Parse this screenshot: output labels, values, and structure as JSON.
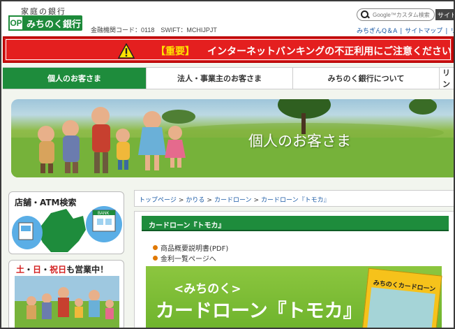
{
  "header": {
    "tagline": "家庭の銀行",
    "logo_mark": "OP",
    "logo_text": "みちのく銀行",
    "bank_code": "金融機関コード：0118　SWIFT：MCHIJPJT",
    "search_placeholder": "Google™カスタム検索",
    "search_button": "サイト",
    "util_links": [
      "みちぎんQ＆A",
      "サイトマップ",
      "リン"
    ]
  },
  "alert": {
    "badge": "【重要】",
    "message": "インターネットバンキングの不正利用にご注意ください"
  },
  "nav": {
    "items": [
      "個人のお客さま",
      "法人・事業主のお客さま",
      "みちのく銀行について",
      "リン"
    ]
  },
  "hero": {
    "title": "個人のお客さま"
  },
  "sidebar": {
    "atm_title": "店舗・ATM検索",
    "atm_sign": "BANK",
    "open_title_parts": [
      "土",
      "・",
      "日",
      "・",
      "祝日",
      "も営業中！"
    ]
  },
  "breadcrumb": {
    "items": [
      "トップページ",
      "かりる",
      "カードローン",
      "カードローン『トモカ』"
    ],
    "separator": ">"
  },
  "content": {
    "section_title": "カードローン『トモカ』",
    "links": [
      "商品概要説明書(PDF)",
      "金利一覧ページへ"
    ],
    "banner_sub": "<みちのく>",
    "banner_main": "カードローン『トモカ』",
    "card_title": "みちのくカードローン"
  },
  "colors": {
    "brand_green": "#1e8c3c",
    "alert_red": "#e41f1f",
    "alert_yellow": "#ffe100",
    "link_blue": "#1b5aa5"
  }
}
